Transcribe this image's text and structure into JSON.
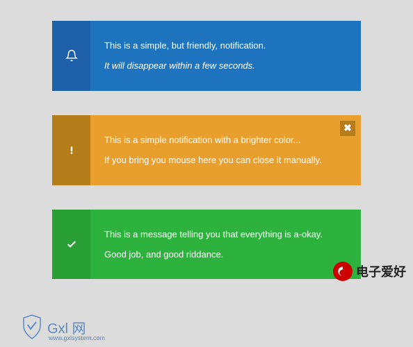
{
  "notifications": [
    {
      "type": "info",
      "color": "blue",
      "icon": "bell",
      "line1": "This is a simple, but friendly, notification.",
      "line2": "It will disappear within a few seconds.",
      "line2_italic": true,
      "closeable": false
    },
    {
      "type": "warning",
      "color": "orange",
      "icon": "exclamation",
      "line1": "This is a simple notification with a brighter color...",
      "line2": "If you bring you mouse here you can close it manually.",
      "line2_italic": false,
      "closeable": true,
      "close_label": "✖"
    },
    {
      "type": "success",
      "color": "green",
      "icon": "check",
      "line1": "This is a message telling you that everything is a-okay.",
      "line2": "Good job, and good riddance.",
      "line2_italic": false,
      "closeable": false
    }
  ],
  "watermarks": {
    "right": {
      "logo_letter": "C",
      "text": "电子爱好"
    },
    "left": {
      "brand": "Gxl 网",
      "url": "www.gxlsystem.com"
    }
  },
  "colors": {
    "blue_dark": "#1d5fa8",
    "blue_light": "#1e73be",
    "orange_dark": "#b47d1a",
    "orange_light": "#e89f2d",
    "green_dark": "#29a035",
    "green_light": "#2eb23e"
  }
}
